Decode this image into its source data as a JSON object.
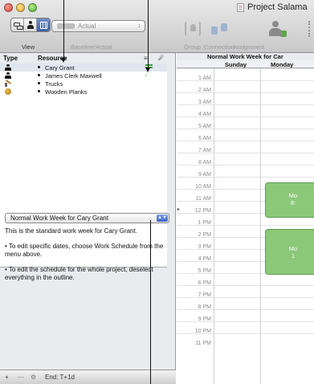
{
  "window": {
    "title": "Project Salama"
  },
  "toolbar": {
    "view_label": "View",
    "baseline_value": "Actual",
    "baseline_label": "Baseline/Actual",
    "group_label": "Group",
    "connection_label": "Connection",
    "assignment_label": "Assignment"
  },
  "outline": {
    "col_type": "Type",
    "col_resource": "Resource",
    "rows": [
      {
        "type": "person",
        "name": "Cary Grant",
        "schedule": "equals-icon",
        "selected": true
      },
      {
        "type": "person",
        "name": "James Clerk Maxwell",
        "schedule": "manual-schedule-icon",
        "selected": false
      },
      {
        "type": "material",
        "name": "Trucks",
        "schedule": "",
        "selected": false
      },
      {
        "type": "wooden",
        "name": "Wooden Planks",
        "schedule": "",
        "selected": false
      }
    ]
  },
  "inspector": {
    "schedule_popup": "Normal Work Week for Cary Grant",
    "desc": "This is the standard work week for Cary Grant.",
    "tip1": "• To edit specific dates, choose Work Schedule from the menu above.",
    "tip2": "• To edit the schedule for the whole project, deselect everything in the outline."
  },
  "bottom": {
    "plus": "+",
    "minus": "—",
    "gear": "⚙",
    "end": "End: T+1d"
  },
  "calendar": {
    "title": "Normal Work Week for Car",
    "days": [
      "Sunday",
      "Monday"
    ],
    "hours": [
      "1 AM",
      "2 AM",
      "3 AM",
      "4 AM",
      "5 AM",
      "6 AM",
      "7 AM",
      "8 AM",
      "9 AM",
      "10 AM",
      "11 AM",
      "12 PM",
      "1 PM",
      "2 PM",
      "3 PM",
      "4 PM",
      "5 PM",
      "6 PM",
      "7 PM",
      "8 PM",
      "9 PM",
      "10 PM",
      "11 PM"
    ],
    "blocks": [
      {
        "line1": "Mo",
        "line2": "8:"
      },
      {
        "line1": "Mo",
        "line2": "1"
      }
    ]
  },
  "colors": {
    "accent": "#3f5f9f",
    "work_block": "#8bc87a",
    "schedule_icon": "#42a13a"
  }
}
